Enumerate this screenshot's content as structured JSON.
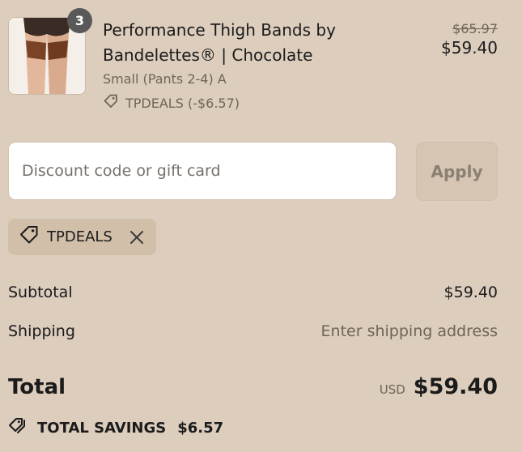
{
  "product": {
    "quantity": "3",
    "name": "Performance Thigh Bands by Bandelettes® | Chocolate",
    "variant": "Small (Pants 2-4) A",
    "discount_line": "TPDEALS (-$6.57)",
    "price_original": "$65.97",
    "price_current": "$59.40",
    "image_icon": "product-photo",
    "tag_icon": "tag-icon"
  },
  "discount": {
    "placeholder": "Discount code or gift card",
    "value": "",
    "apply_label": "Apply",
    "applied_code": "TPDEALS",
    "remove_icon": "close-icon"
  },
  "summary": {
    "subtotal_label": "Subtotal",
    "subtotal_value": "$59.40",
    "shipping_label": "Shipping",
    "shipping_value": "Enter shipping address",
    "total_label": "Total",
    "currency": "USD",
    "total_value": "$59.40",
    "savings_label": "TOTAL SAVINGS",
    "savings_value": "$6.57"
  },
  "colors": {
    "background": "#dccdbd",
    "badge": "#595959",
    "applied_tag_bg": "#d2bfa9",
    "muted_text": "#6f6559"
  }
}
